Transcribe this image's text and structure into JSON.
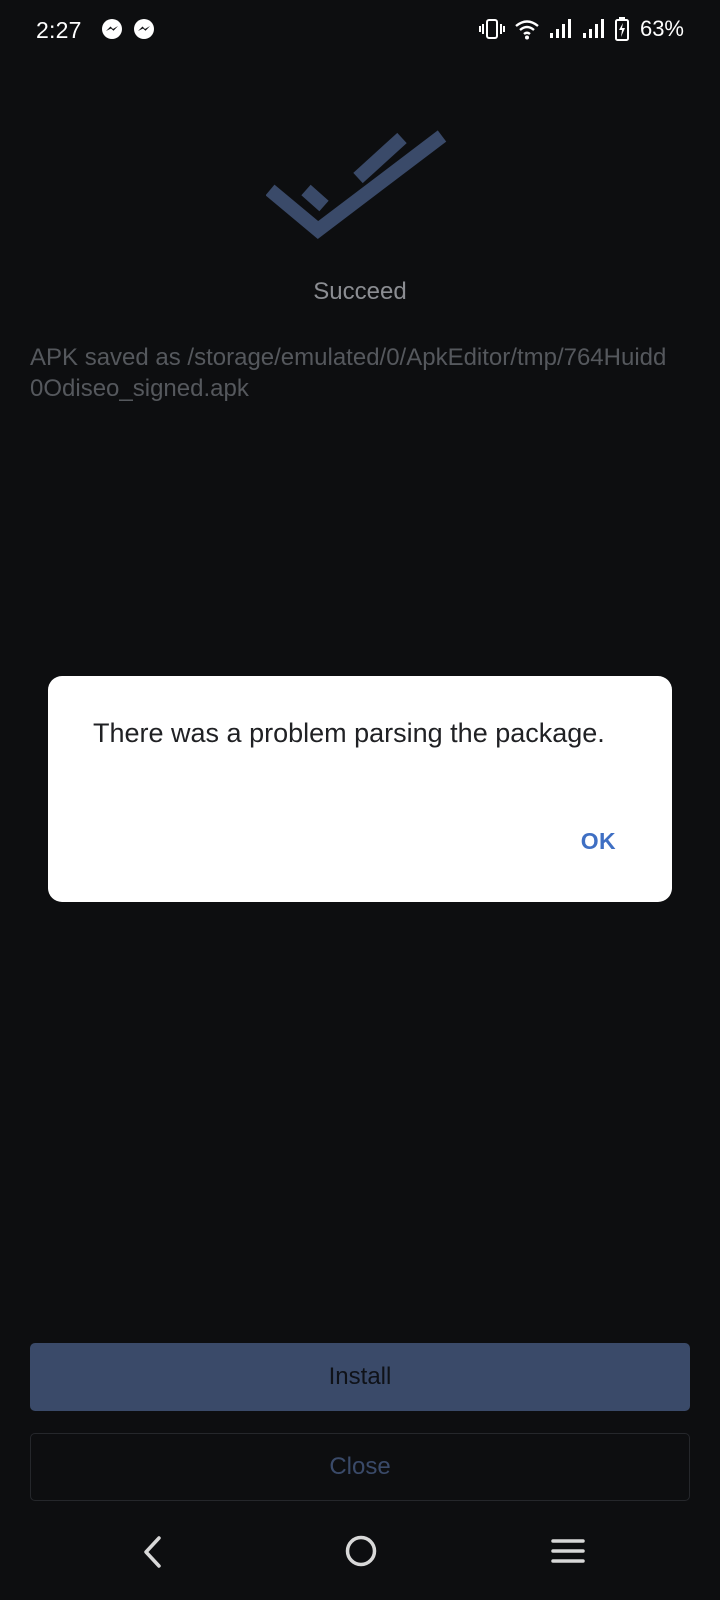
{
  "status_bar": {
    "time": "2:27",
    "battery_percent": "63%",
    "left_icons": [
      "messenger-icon",
      "messenger-icon"
    ],
    "right_icons": [
      "vibrate-icon",
      "wifi-icon",
      "signal-icon",
      "signal-icon",
      "battery-charging-icon"
    ]
  },
  "content": {
    "success_icon": "double-check-icon",
    "status_label": "Succeed",
    "saved_message": "APK saved as /storage/emulated/0/ApkEditor/tmp/764Huidd0Odiseo_signed.apk"
  },
  "dialog": {
    "message": "There was a problem parsing the package.",
    "ok_label": "OK"
  },
  "buttons": {
    "install_label": "Install",
    "close_label": "Close"
  },
  "navigation": {
    "icons": [
      "back-icon",
      "home-icon",
      "recents-icon"
    ]
  },
  "colors": {
    "background": "#0d0e10",
    "accent": "#3a4a69",
    "dialog_background": "#ffffff",
    "dialog_button": "#3f6fc3"
  }
}
